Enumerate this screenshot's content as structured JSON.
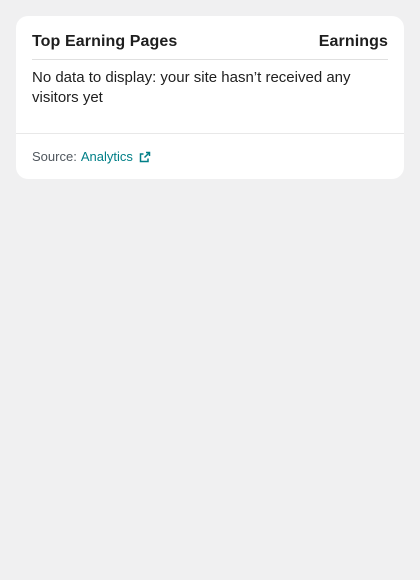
{
  "card": {
    "header": {
      "title": "Top Earning Pages",
      "column": "Earnings"
    },
    "empty_message": "No data to display: your site hasn’t received any visitors yet",
    "footer": {
      "source_label": "Source:",
      "source_link": "Analytics",
      "source_icon": "external-link-icon"
    }
  },
  "colors": {
    "page_background": "#f0f0f1",
    "card_background": "#ffffff",
    "accent": "#007f87"
  }
}
